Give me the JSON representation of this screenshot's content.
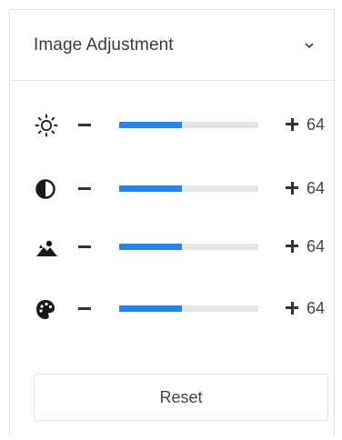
{
  "panel": {
    "title": "Image Adjustment",
    "collapse_icon": "chevron-down-icon"
  },
  "adjustments": [
    {
      "icon": "brightness-icon",
      "value_label": "64",
      "level": 0.45
    },
    {
      "icon": "contrast-icon",
      "value_label": "64",
      "level": 0.45
    },
    {
      "icon": "saturation-icon",
      "value_label": "64",
      "level": 0.45
    },
    {
      "icon": "hue-icon",
      "value_label": "64",
      "level": 0.45
    }
  ],
  "reset_label": "Reset",
  "colors": {
    "slider_fill": "#2b82e6",
    "slider_track": "#e5e5e5"
  }
}
